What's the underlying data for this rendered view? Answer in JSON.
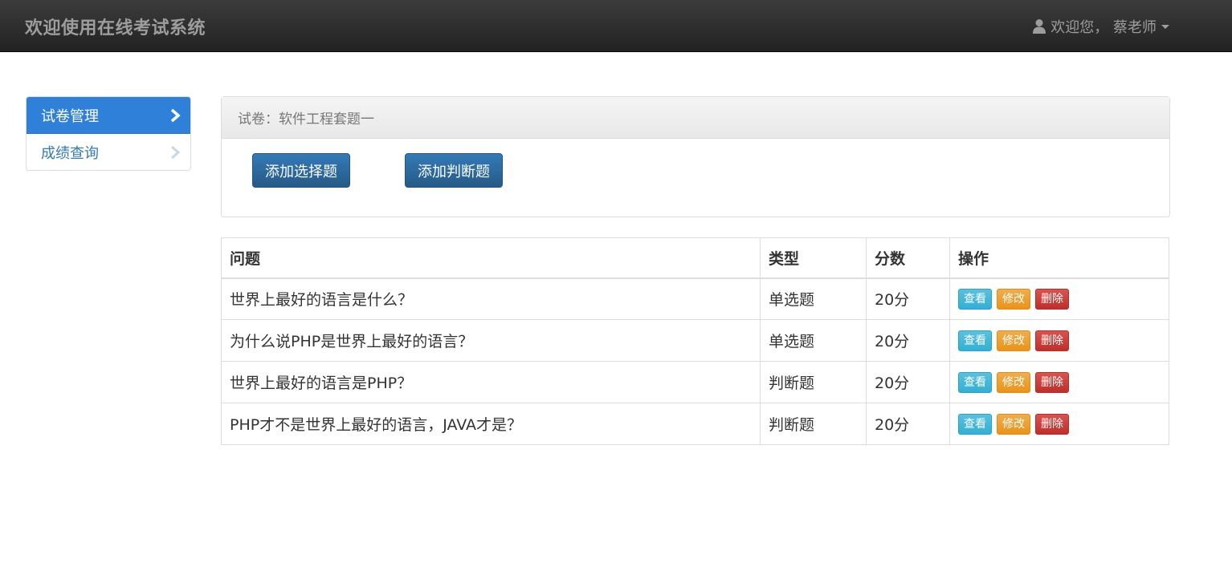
{
  "navbar": {
    "brand": "欢迎使用在线考试系统",
    "user_greeting": "欢迎您， 蔡老师"
  },
  "sidebar": {
    "items": [
      {
        "label": "试卷管理"
      },
      {
        "label": "成绩查询"
      }
    ]
  },
  "panel": {
    "heading": "试卷：软件工程套题一",
    "add_choice_label": "添加选择题",
    "add_judge_label": "添加判断题"
  },
  "table": {
    "headers": [
      "问题",
      "类型",
      "分数",
      "操作"
    ],
    "rows": [
      {
        "question": "世界上最好的语言是什么？",
        "type": "单选题",
        "score": "20分"
      },
      {
        "question": "为什么说PHP是世界上最好的语言？",
        "type": "单选题",
        "score": "20分"
      },
      {
        "question": "世界上最好的语言是PHP？",
        "type": "判断题",
        "score": "20分"
      },
      {
        "question": "PHP才不是世界上最好的语言，JAVA才是？",
        "type": "判断题",
        "score": "20分"
      }
    ],
    "actions": {
      "view": "查看",
      "edit": "修改",
      "delete": "删除"
    }
  },
  "icons": {
    "user": "user-icon",
    "caret": "caret-down-icon",
    "chevron": "chevron-right-icon"
  },
  "colors": {
    "navbar": "#222222",
    "active_sidebar": "#2f80d8",
    "primary": "#337ab7",
    "info": "#5bc0de",
    "warning": "#f0ad4e",
    "danger": "#d9534f"
  }
}
